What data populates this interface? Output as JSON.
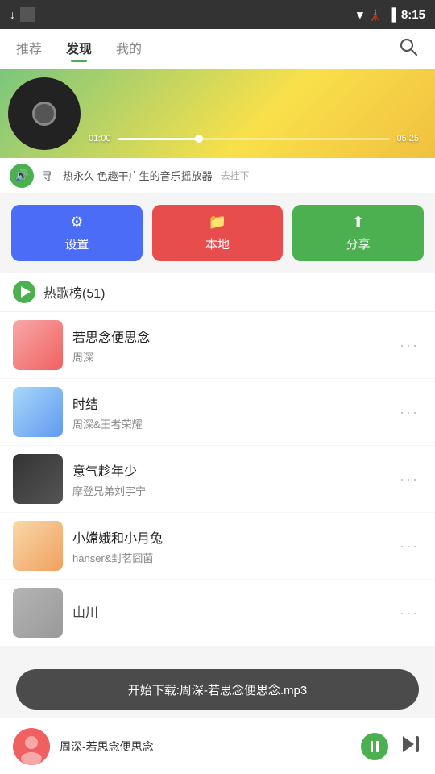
{
  "statusBar": {
    "time": "8:15",
    "download": "↓",
    "square": "▪"
  },
  "nav": {
    "tabs": [
      {
        "label": "推荐",
        "active": false
      },
      {
        "label": "发现",
        "active": true
      },
      {
        "label": "我的",
        "active": false
      }
    ],
    "searchLabel": "搜索"
  },
  "banner": {
    "timeStart": "01:00",
    "timeEnd": "05:25"
  },
  "scrollTextBar": {
    "text": "寻—热永久 色趣干广生的音乐摇放器",
    "tag": "去挂下"
  },
  "actionButtons": [
    {
      "label": "设置",
      "icon": "⚙",
      "color": "blue"
    },
    {
      "label": "本地",
      "icon": "📁",
      "color": "red"
    },
    {
      "label": "分享",
      "icon": "⬆",
      "color": "green"
    }
  ],
  "hotSongs": {
    "title": "热歌榜",
    "count": "(51)"
  },
  "songs": [
    {
      "title": "若思念便思念",
      "artist": "周深",
      "coverClass": "cover-1"
    },
    {
      "title": "时结",
      "artist": "周深&王者荣耀",
      "coverClass": "cover-2"
    },
    {
      "title": "意气趁年少",
      "artist": "摩登兄弟刘宇宁",
      "coverClass": "cover-3"
    },
    {
      "title": "小嫦娥和小月兔",
      "artist": "hanser&封茗囧菌",
      "coverClass": "cover-4"
    },
    {
      "title": "山川",
      "artist": "",
      "coverClass": "cover-5"
    }
  ],
  "downloadToast": "开始下载:周深-若思念便思念.mp3",
  "player": {
    "songTitle": "周深-若思念便思念"
  },
  "moreIcon": "···"
}
